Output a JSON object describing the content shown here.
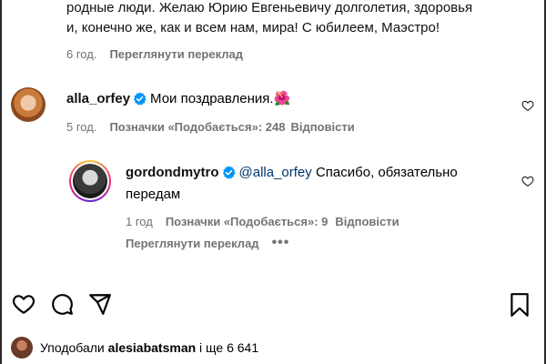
{
  "top_comment": {
    "line1": "родные люди. Желаю Юрию Евгеньевичу долголетия, здоровья",
    "line2": "и, конечно же, как и всем нам, мира! С юбилеем, Маэстро!",
    "time": "6 год.",
    "translate": "Переглянути переклад"
  },
  "comment_alla": {
    "username": "alla_orfey",
    "text": "Мои поздравления.🌺",
    "time": "5 год.",
    "likes": "Позначки «Подобається»: 248",
    "reply": "Відповісти"
  },
  "reply_gordon": {
    "username": "gordondmytro",
    "mention": "@alla_orfey",
    "text_line1": "Спасибо, обязательно",
    "text_line2": "передам",
    "time": "1 год",
    "likes": "Позначки «Подобається»: 9",
    "reply": "Відповісти",
    "translate": "Переглянути переклад",
    "more": "•••"
  },
  "liked_by": {
    "prefix": "Уподобали",
    "user": "alesiabatsman",
    "suffix": "і ще 6 641"
  },
  "colors": {
    "verified": "#0095f6",
    "meta": "#737373",
    "mention": "#00376b"
  },
  "icons": [
    "heart-icon",
    "comment-icon",
    "share-icon",
    "bookmark-icon",
    "verified-badge-icon"
  ]
}
